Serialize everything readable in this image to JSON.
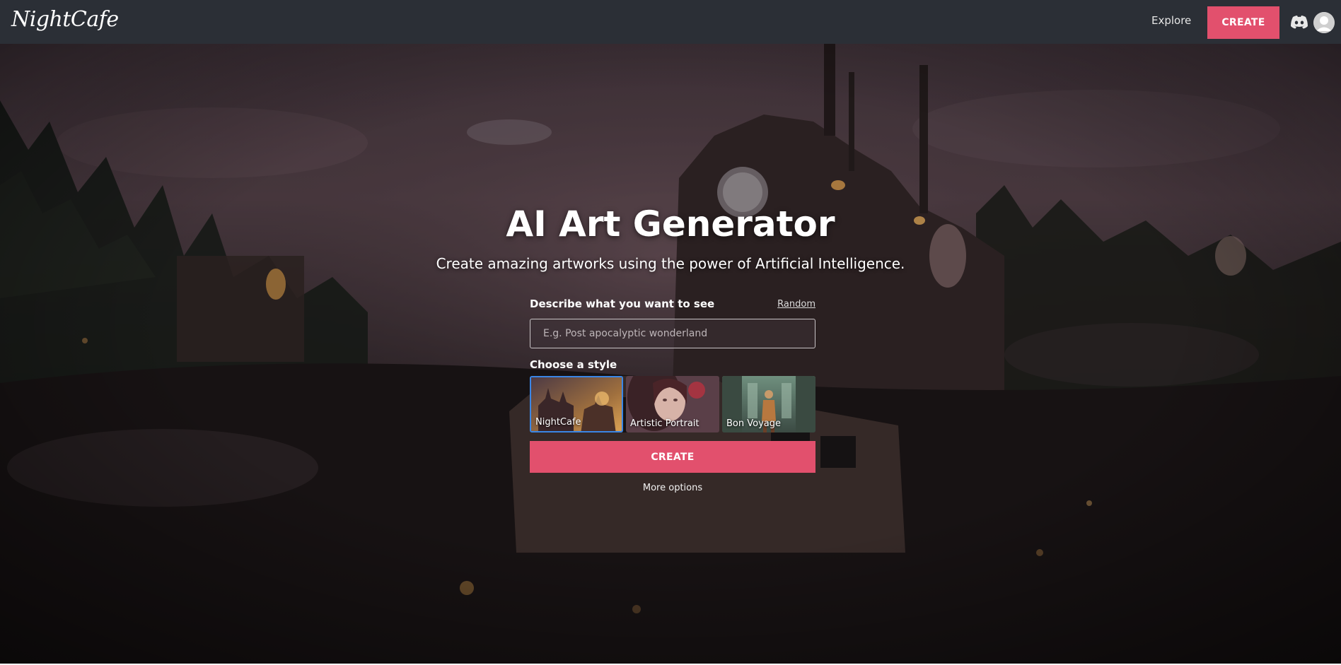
{
  "header": {
    "logo_text": "NightCafe",
    "nav_explore": "Explore",
    "nav_create": "CREATE",
    "icons": {
      "discord": "discord-icon",
      "avatar": "user-avatar"
    }
  },
  "hero": {
    "title": "AI Art Generator",
    "subtitle": "Create amazing artworks using the power of Artificial Intelligence."
  },
  "form": {
    "describe_label": "Describe what you want to see",
    "random_link": "Random",
    "prompt_placeholder": "E.g. Post apocalyptic wonderland",
    "prompt_value": "",
    "style_label": "Choose a style",
    "styles": [
      {
        "name": "NightCafe",
        "selected": true
      },
      {
        "name": "Artistic Portrait",
        "selected": false
      },
      {
        "name": "Bon Voyage",
        "selected": false
      }
    ],
    "create_button": "CREATE",
    "more_options": "More options"
  },
  "colors": {
    "topbar": "#2b2f36",
    "accent": "#e2506d",
    "selected_border": "#3a86e6"
  }
}
